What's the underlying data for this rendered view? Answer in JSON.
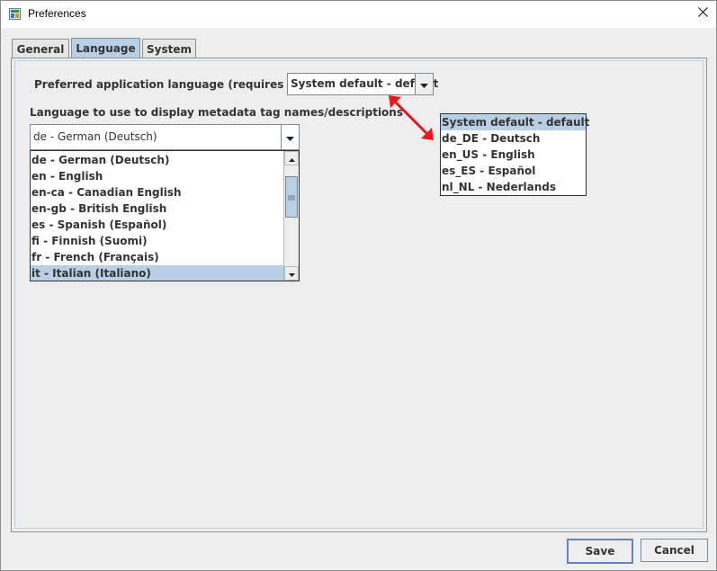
{
  "window": {
    "title": "Preferences",
    "app_icon": "java-app-icon",
    "close_icon": "close-icon"
  },
  "tabs": [
    {
      "label": "General",
      "active": false
    },
    {
      "label": "Language",
      "active": true
    },
    {
      "label": "System",
      "active": false
    }
  ],
  "language_panel": {
    "preferred_label": "Preferred application language (requires restart)",
    "preferred_value": "System default - default",
    "preferred_options": [
      "System default - default",
      "de_DE - Deutsch",
      "en_US - English",
      "es_ES - Español",
      "nl_NL - Nederlands"
    ],
    "preferred_selected_index": 0,
    "metadata_label": "Language to use to display metadata tag names/descriptions",
    "metadata_value": "de - German (Deutsch)",
    "metadata_options": [
      "de - German (Deutsch)",
      "en - English",
      "en-ca - Canadian English",
      "en-gb - British English",
      "es - Spanish (Español)",
      "fi - Finnish (Suomi)",
      "fr - French (Français)",
      "it - Italian (Italiano)"
    ],
    "metadata_highlighted_index": 7
  },
  "annotation": {
    "arrow_color": "#e8191d",
    "type": "double-headed-arrow"
  },
  "footer": {
    "save_label": "Save",
    "cancel_label": "Cancel"
  },
  "colors": {
    "selection": "#b8cfe5",
    "background": "#eeeeee",
    "default_button_border": "#6382bf"
  }
}
